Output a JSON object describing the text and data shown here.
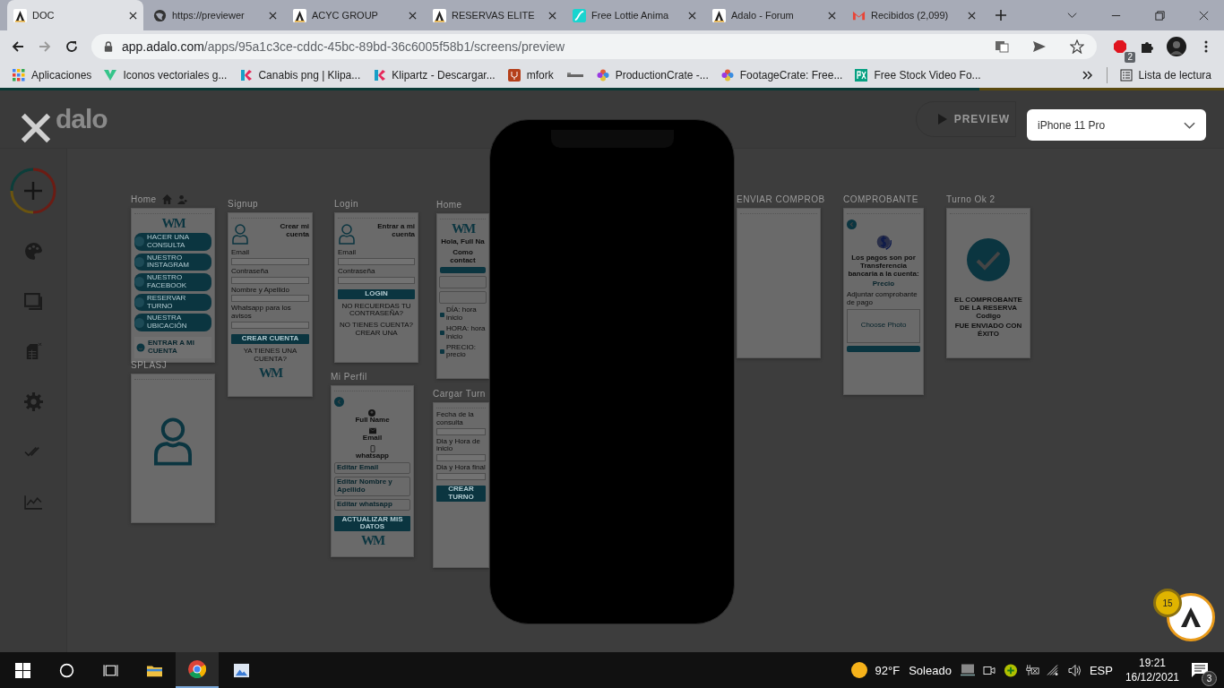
{
  "browser": {
    "tabs": [
      {
        "title": "DOC",
        "kind": "adalo",
        "selected": true
      },
      {
        "title": "https://previewer",
        "kind": "globe",
        "selected": false
      },
      {
        "title": "ACYC GROUP",
        "kind": "adalo",
        "selected": false
      },
      {
        "title": "RESERVAS ELITE",
        "kind": "adalo",
        "selected": false
      },
      {
        "title": "Free Lottie Anima",
        "kind": "lottie",
        "selected": false
      },
      {
        "title": "Adalo - Forum",
        "kind": "adalo",
        "selected": false
      },
      {
        "title": "Recibidos (2,099)",
        "kind": "mail",
        "selected": false
      }
    ],
    "address": {
      "host": "app.adalo.com",
      "path": "/apps/95a1c3ce-cddc-45bc-89bd-36c6005f58b1/screens/preview"
    },
    "extension_badge": "2",
    "bookmarks": [
      {
        "label": "Aplicaciones",
        "kind": "apps"
      },
      {
        "label": "Iconos vectoriales g...",
        "kind": "v"
      },
      {
        "label": "Canabis png | Klipa...",
        "kind": "k"
      },
      {
        "label": "Klipartz - Descargar...",
        "kind": "k"
      },
      {
        "label": "mfork",
        "kind": "fork"
      },
      {
        "kind": "tiny"
      },
      {
        "label": "ProductionCrate -...",
        "kind": "crate"
      },
      {
        "label": "FootageCrate: Free...",
        "kind": "crate"
      },
      {
        "label": "Free Stock Video Fo...",
        "kind": "px"
      }
    ],
    "reading_list": "Lista de lectura"
  },
  "app": {
    "logo": "dalo",
    "preview_button": "PREVIEW",
    "device": "iPhone 11 Pro",
    "notification_count": "15",
    "screens": [
      {
        "title": "Home",
        "home_screen": true,
        "items": [
          {
            "kind": "logo",
            "text": "WM"
          },
          {
            "kind": "pill",
            "text": "HACER UNA CONSULTA"
          },
          {
            "kind": "pill",
            "text": "NUESTRO INSTAGRAM"
          },
          {
            "kind": "pill",
            "text": "NUESTRO FACEBOOK"
          },
          {
            "kind": "pill",
            "text": "RESERVAR TURNO"
          },
          {
            "kind": "pill",
            "text": "NUESTRA UBICACIÓN"
          },
          {
            "kind": "account",
            "text": "ENTRAR A MI CUENTA"
          }
        ]
      },
      {
        "title": "SPLASJ",
        "home_screen": false,
        "items": [
          {
            "kind": "avatar"
          }
        ]
      },
      {
        "title": "Signup",
        "home_screen": false,
        "items": [
          {
            "kind": "heading",
            "text": "Crear mi cuenta"
          },
          {
            "kind": "field",
            "text": "Email"
          },
          {
            "kind": "field",
            "text": "Contraseña"
          },
          {
            "kind": "field",
            "text": "Nombre y Apellido"
          },
          {
            "kind": "field",
            "text": "Whatsapp para los avisos"
          },
          {
            "kind": "button",
            "text": "CREAR CUENTA"
          },
          {
            "kind": "link",
            "text": "YA TIENES UNA CUENTA?"
          },
          {
            "kind": "logo",
            "text": "WM"
          }
        ]
      },
      {
        "title": "Login",
        "home_screen": false,
        "items": [
          {
            "kind": "heading",
            "text": "Entrar a mi cuenta"
          },
          {
            "kind": "field",
            "text": "Email"
          },
          {
            "kind": "field",
            "text": "Contraseña"
          },
          {
            "kind": "button",
            "text": "LOGIN"
          },
          {
            "kind": "link",
            "text": "NO RECUERDAS TU CONTRASEÑA?"
          },
          {
            "kind": "link",
            "text": "NO TIENES CUENTA? CREAR UNA"
          }
        ]
      },
      {
        "title": "Mi Perfil",
        "home_screen": false,
        "items": [
          {
            "kind": "back"
          },
          {
            "kind": "person",
            "text": "Full Name"
          },
          {
            "kind": "mail",
            "text": "Email"
          },
          {
            "kind": "phone",
            "text": "whatsapp"
          },
          {
            "kind": "input",
            "text": "Editar Email"
          },
          {
            "kind": "input",
            "text": "Editar Nombre y Apellido"
          },
          {
            "kind": "input",
            "text": "Editar whatsapp"
          },
          {
            "kind": "button",
            "text": "ACTUALIZAR MIS DATOS"
          },
          {
            "kind": "logo",
            "text": "WM"
          }
        ]
      },
      {
        "title": "Home",
        "home_screen": false,
        "items": [
          {
            "kind": "logo",
            "text": "WM"
          },
          {
            "kind": "text",
            "text": "Hola, Full Na"
          },
          {
            "kind": "text",
            "text": "Como contact"
          },
          {
            "kind": "bar"
          },
          {
            "kind": "card"
          },
          {
            "kind": "card"
          },
          {
            "kind": "row",
            "text": "DÍA: hora inicio"
          },
          {
            "kind": "row",
            "text": "HORA: hora inicio"
          },
          {
            "kind": "row",
            "text": "PRECIO: precio"
          }
        ]
      },
      {
        "title": "Cargar Turn",
        "home_screen": false,
        "items": [
          {
            "kind": "field",
            "text": "Fecha de la consulta"
          },
          {
            "kind": "field",
            "text": "Dia y Hora de inicio"
          },
          {
            "kind": "field",
            "text": "Dia y Hora final"
          },
          {
            "kind": "button",
            "text": "CREAR TURNO"
          }
        ]
      },
      {
        "title": "ENVIAR COMPROB",
        "home_screen": false
      },
      {
        "title": "COMPROBANTE",
        "home_screen": false,
        "items": [
          {
            "kind": "back"
          },
          {
            "kind": "dollar"
          },
          {
            "kind": "text",
            "text": "Los pagos son por Transferencia bancaria a la cuenta:"
          },
          {
            "kind": "price",
            "text": "Precio"
          },
          {
            "kind": "upload",
            "text": "Adjuntar comprobante de pago",
            "action": "Choose Photo"
          },
          {
            "kind": "bar"
          }
        ]
      },
      {
        "title": "Turno Ok 2",
        "home_screen": false,
        "items": [
          {
            "kind": "check"
          },
          {
            "kind": "text",
            "text": "EL COMPROBANTE DE LA RESERVA Codigo"
          },
          {
            "kind": "text",
            "text": "FUE ENVIADO CON ÉXITO"
          }
        ]
      }
    ]
  },
  "taskbar": {
    "temperature": "92°F",
    "weather": "Soleado",
    "language": "ESP",
    "time": "19:21",
    "date": "16/12/2021",
    "notifications": "3"
  }
}
